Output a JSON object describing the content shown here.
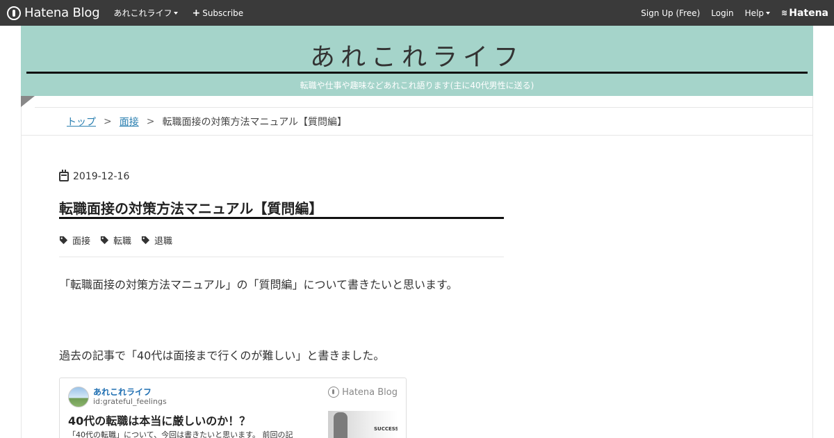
{
  "navbar": {
    "brand": "Hatena Blog",
    "blog_menu": "あれこれライフ",
    "subscribe": "Subscribe",
    "signup": "Sign Up (Free)",
    "login": "Login",
    "help": "Help",
    "hatena": "Hatena"
  },
  "header": {
    "title": "あれこれライフ",
    "description": "転職や仕事や趣味などあれこれ語ります(主に40代男性に送る)",
    "accent_color": "#a5d4ca"
  },
  "breadcrumb": {
    "top": "トップ",
    "separator": ">",
    "category": "面接",
    "current": "転職面接の対策方法マニュアル【質問編】"
  },
  "entry": {
    "date": "2019-12-16",
    "title": "転職面接の対策方法マニュアル【質問編】",
    "tags": [
      "面接",
      "転職",
      "退職"
    ],
    "paragraphs": [
      "「転職面接の対策方法マニュアル」の「質問編」について書きたいと思います。",
      "過去の記事で「40代は面接まで行くのが難しい」と書きました。"
    ]
  },
  "embed": {
    "blog_name": "あれこれライフ",
    "user_id": "id:grateful_feelings",
    "logo_text": "Hatena Blog",
    "title": "40代の転職は本当に厳しいのか！？",
    "excerpt": "「40代の転職」について、今回は書きたいと思います。 前回の記",
    "thumb_word": "SUCCESS"
  }
}
